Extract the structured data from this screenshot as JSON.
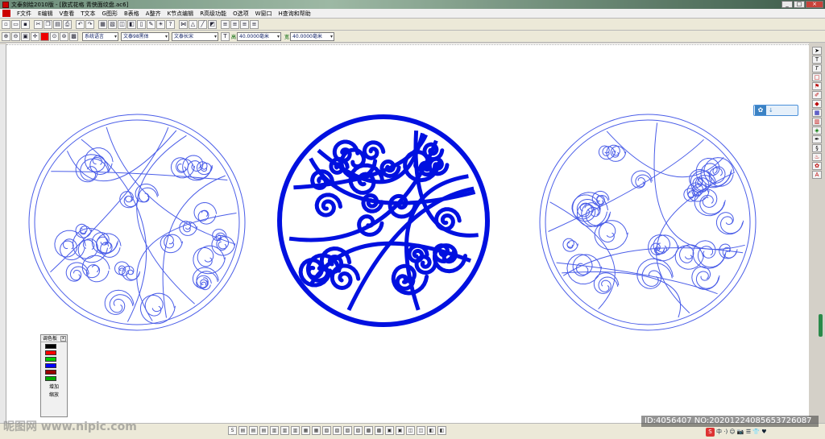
{
  "window": {
    "title": "文泰刻绘2010版 - [欧式花格  青侠面纹盘.ac6]",
    "buttons": [
      "_",
      "□",
      "×"
    ]
  },
  "menu": [
    "F文件",
    "E编辑",
    "V查看",
    "T文本",
    "G图形",
    "B表格",
    "A整齐",
    "K节点编辑",
    "R高级功能",
    "O选项",
    "W窗口",
    "H查询和帮助"
  ],
  "toolbar2": {
    "font_lang": "系统语言",
    "font_name": "文泰98黑体",
    "font_style": "文泰长宋",
    "height_label": "高",
    "height_value": "40.0000毫米",
    "width_label": "宽",
    "width_value": "40.0000毫米"
  },
  "palette": {
    "title": "调色板",
    "close": "x",
    "colors": [
      "#000000",
      "#ff0000",
      "#00cc00",
      "#0000ff",
      "#990000",
      "#00aa00"
    ],
    "add_label": "增加",
    "bottom_label": "缩放"
  },
  "art": {
    "outline_color": "#4a5de8",
    "filled_color": "#0010e0"
  },
  "watermark": {
    "left_text": "昵图网 www.nipic.com",
    "id_text": "ID:4056407 NO:20201224085653726087"
  },
  "tray": {
    "ime_label": "S",
    "ime_text": "中 ·) ☺ 📷 ☰ 👕 ♥"
  },
  "colors": {
    "titlebar": "#6d8d7a",
    "scroll_thumb": "#2a8a4a",
    "panel_accent": "#3b82c4"
  }
}
